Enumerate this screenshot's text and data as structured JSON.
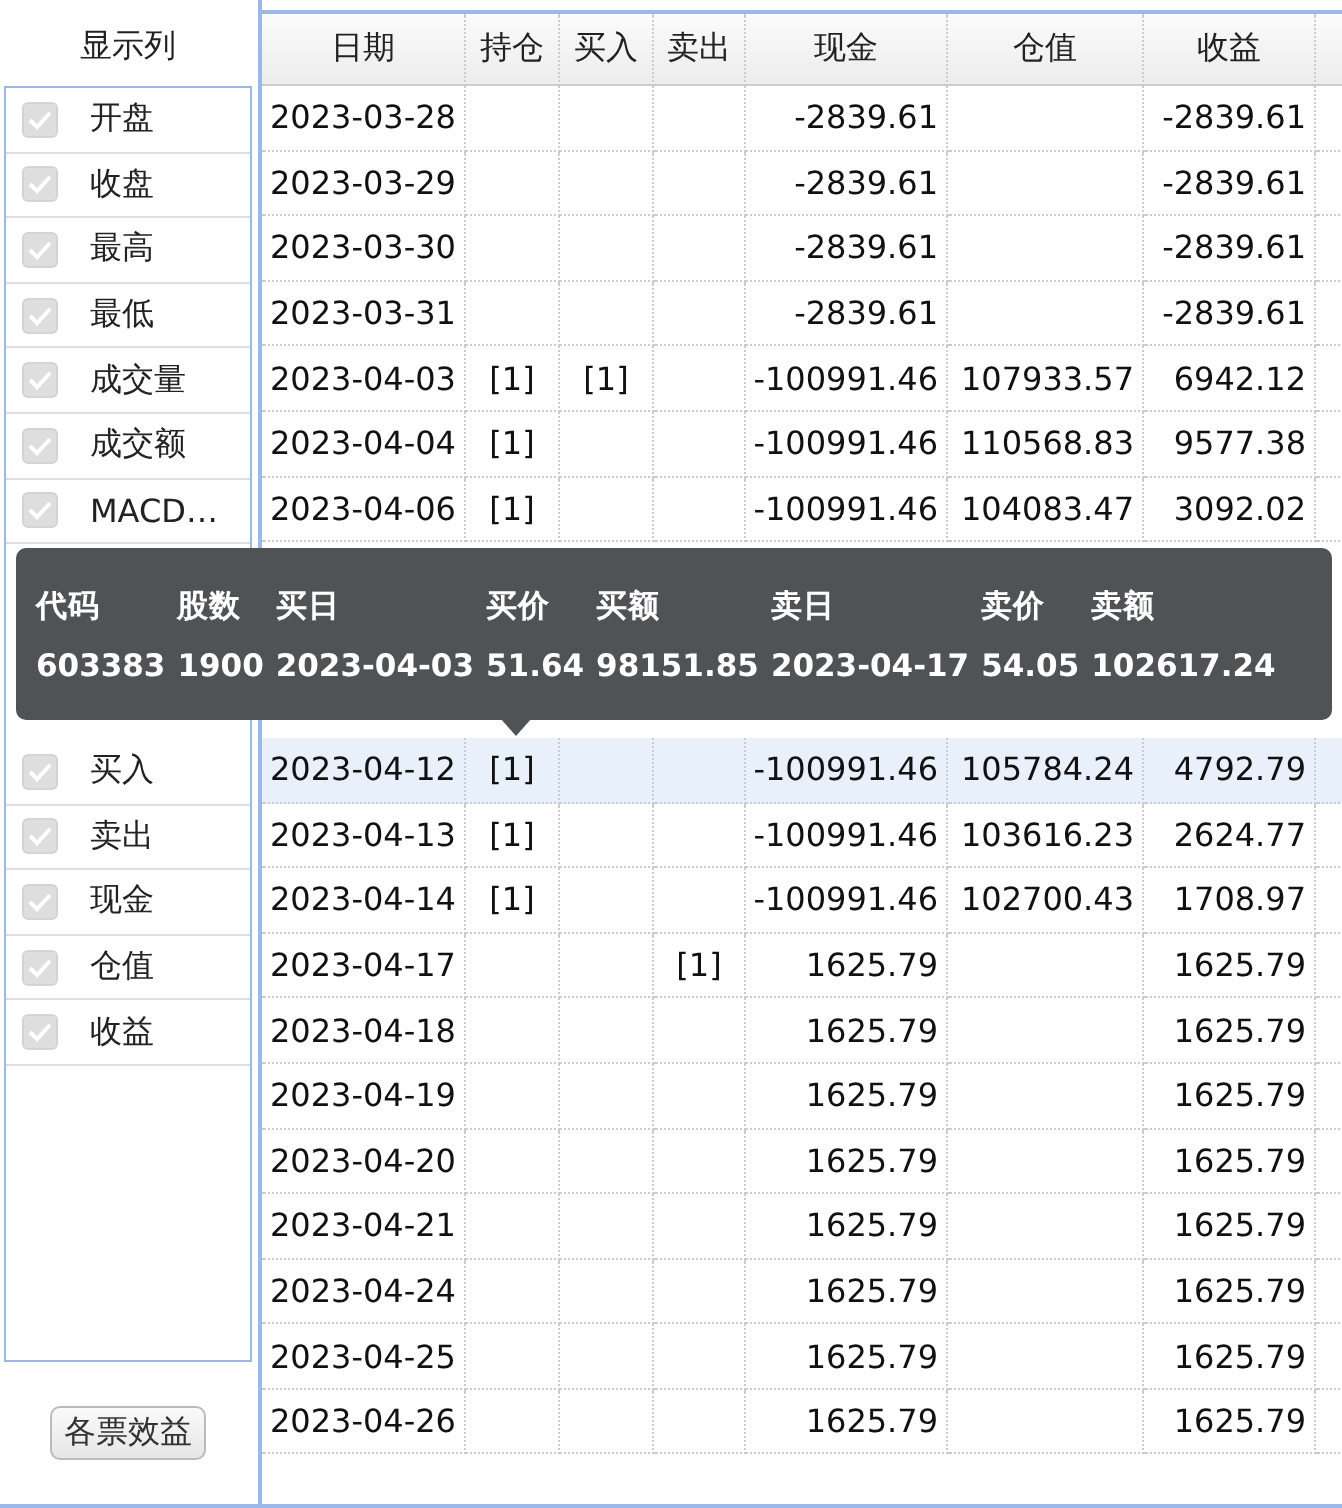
{
  "sidebar": {
    "title": "显示列",
    "items": [
      {
        "label": "开盘",
        "checked": true,
        "disabled": true
      },
      {
        "label": "收盘",
        "checked": true,
        "disabled": true
      },
      {
        "label": "最高",
        "checked": true,
        "disabled": true
      },
      {
        "label": "最低",
        "checked": true,
        "disabled": true
      },
      {
        "label": "成交量",
        "checked": true,
        "disabled": true
      },
      {
        "label": "成交额",
        "checked": true,
        "disabled": true
      },
      {
        "label": "MACD…",
        "checked": true,
        "disabled": true
      },
      {
        "label": "买入",
        "checked": true,
        "disabled": true
      },
      {
        "label": "卖出",
        "checked": true,
        "disabled": true
      },
      {
        "label": "现金",
        "checked": true,
        "disabled": true
      },
      {
        "label": "仓值",
        "checked": true,
        "disabled": true
      },
      {
        "label": "收益",
        "checked": true,
        "disabled": true
      }
    ],
    "button": "各票效益"
  },
  "table": {
    "columns": [
      "日期",
      "持仓",
      "买入",
      "卖出",
      "现金",
      "仓值",
      "收益"
    ],
    "rows": [
      {
        "selected": false,
        "cells": [
          "2023-03-28",
          "",
          "",
          "",
          "-2839.61",
          "",
          "-2839.61"
        ]
      },
      {
        "selected": false,
        "cells": [
          "2023-03-29",
          "",
          "",
          "",
          "-2839.61",
          "",
          "-2839.61"
        ]
      },
      {
        "selected": false,
        "cells": [
          "2023-03-30",
          "",
          "",
          "",
          "-2839.61",
          "",
          "-2839.61"
        ]
      },
      {
        "selected": false,
        "cells": [
          "2023-03-31",
          "",
          "",
          "",
          "-2839.61",
          "",
          "-2839.61"
        ]
      },
      {
        "selected": false,
        "cells": [
          "2023-04-03",
          "[1]",
          "[1]",
          "",
          "-100991.46",
          "107933.57",
          "6942.12"
        ]
      },
      {
        "selected": false,
        "cells": [
          "2023-04-04",
          "[1]",
          "",
          "",
          "-100991.46",
          "110568.83",
          "9577.38"
        ]
      },
      {
        "selected": false,
        "cells": [
          "2023-04-06",
          "[1]",
          "",
          "",
          "-100991.46",
          "104083.47",
          "3092.02"
        ]
      },
      {
        "selected": true,
        "cells": [
          "2023-04-12",
          "[1]",
          "",
          "",
          "-100991.46",
          "105784.24",
          "4792.79"
        ]
      },
      {
        "selected": false,
        "cells": [
          "2023-04-13",
          "[1]",
          "",
          "",
          "-100991.46",
          "103616.23",
          "2624.77"
        ]
      },
      {
        "selected": false,
        "cells": [
          "2023-04-14",
          "[1]",
          "",
          "",
          "-100991.46",
          "102700.43",
          "1708.97"
        ]
      },
      {
        "selected": false,
        "cells": [
          "2023-04-17",
          "",
          "",
          "[1]",
          "1625.79",
          "",
          "1625.79"
        ]
      },
      {
        "selected": false,
        "cells": [
          "2023-04-18",
          "",
          "",
          "",
          "1625.79",
          "",
          "1625.79"
        ]
      },
      {
        "selected": false,
        "cells": [
          "2023-04-19",
          "",
          "",
          "",
          "1625.79",
          "",
          "1625.79"
        ]
      },
      {
        "selected": false,
        "cells": [
          "2023-04-20",
          "",
          "",
          "",
          "1625.79",
          "",
          "1625.79"
        ]
      },
      {
        "selected": false,
        "cells": [
          "2023-04-21",
          "",
          "",
          "",
          "1625.79",
          "",
          "1625.79"
        ]
      },
      {
        "selected": false,
        "cells": [
          "2023-04-24",
          "",
          "",
          "",
          "1625.79",
          "",
          "1625.79"
        ]
      },
      {
        "selected": false,
        "cells": [
          "2023-04-25",
          "",
          "",
          "",
          "1625.79",
          "",
          "1625.79"
        ]
      },
      {
        "selected": false,
        "cells": [
          "2023-04-26",
          "",
          "",
          "",
          "1625.79",
          "",
          "1625.79"
        ]
      }
    ]
  },
  "tooltip": {
    "headers": [
      "代码",
      "股数",
      "买日",
      "买价",
      "买额",
      "卖日",
      "卖价",
      "卖额"
    ],
    "values": [
      "603383",
      "1900",
      "2023-04-03",
      "51.64",
      "98151.85",
      "2023-04-17",
      "54.05",
      "102617.24"
    ]
  }
}
